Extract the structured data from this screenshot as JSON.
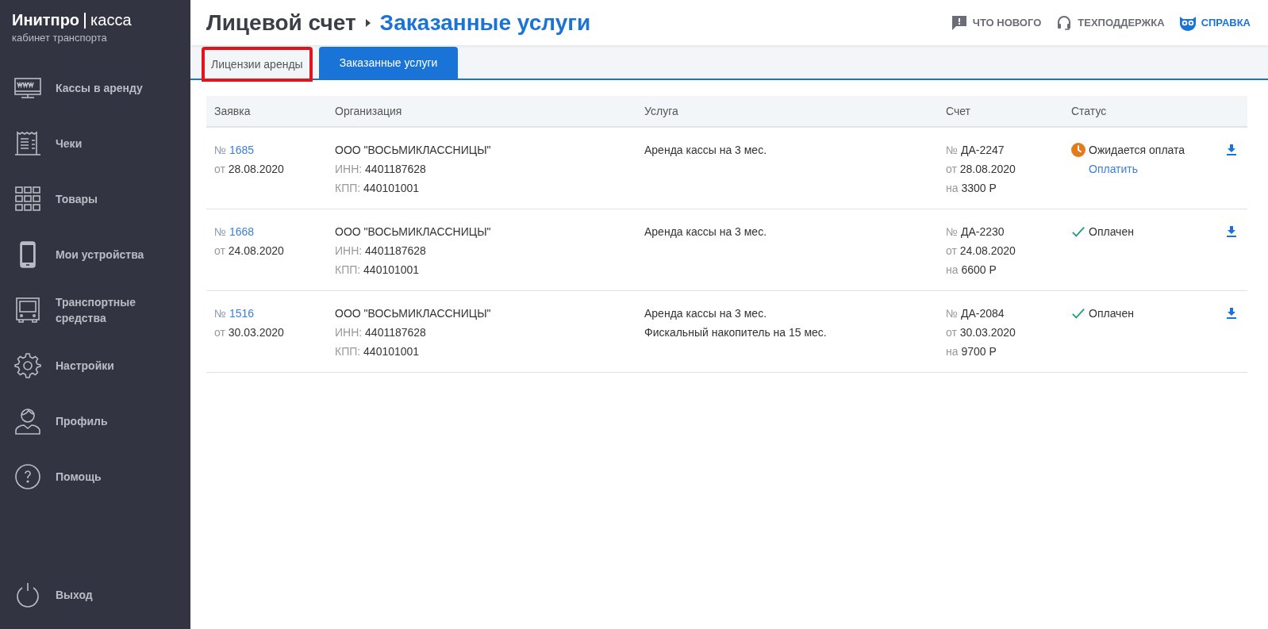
{
  "logo": {
    "brand": "Инитпро",
    "product": "касса",
    "subtitle": "кабинет транспорта"
  },
  "sidebar": {
    "items": [
      {
        "label": "Кассы в аренду"
      },
      {
        "label": "Чеки"
      },
      {
        "label": "Товары"
      },
      {
        "label": "Мои устройства"
      },
      {
        "label": "Транспортные средства"
      },
      {
        "label": "Настройки"
      },
      {
        "label": "Профиль"
      },
      {
        "label": "Помощь"
      }
    ],
    "logout": {
      "label": "Выход"
    }
  },
  "header": {
    "breadcrumb": "Лицевой счет",
    "title": "Заказанные услуги",
    "links": [
      {
        "label": "ЧТО НОВОГО"
      },
      {
        "label": "ТЕХПОДДЕРЖКА"
      },
      {
        "label": "СПРАВКА"
      }
    ]
  },
  "tabs": [
    {
      "label": "Лицензии аренды",
      "selected": false,
      "highlighted": true
    },
    {
      "label": "Заказанные услуги",
      "selected": true,
      "highlighted": false
    }
  ],
  "table": {
    "columns": [
      "Заявка",
      "Организация",
      "Услуга",
      "Счет",
      "Статус"
    ],
    "rows": [
      {
        "number_label": "№",
        "number": "1685",
        "date_label": "от",
        "date": "28.08.2020",
        "org": "ООО \"ВОСЬМИКЛАССНИЦЫ\"",
        "inn_label": "ИНН:",
        "inn": "4401187628",
        "kpp_label": "КПП:",
        "kpp": "440101001",
        "services": [
          "Аренда кассы на 3 мес."
        ],
        "invoice_label": "№",
        "invoice": "ДА-2247",
        "invoice_date_label": "от",
        "invoice_date": "28.08.2020",
        "amount_label": "на",
        "amount": "3300 Р",
        "status": {
          "kind": "pending",
          "label": "Ожидается оплата",
          "action": "Оплатить"
        }
      },
      {
        "number_label": "№",
        "number": "1668",
        "date_label": "от",
        "date": "24.08.2020",
        "org": "ООО \"ВОСЬМИКЛАССНИЦЫ\"",
        "inn_label": "ИНН:",
        "inn": "4401187628",
        "kpp_label": "КПП:",
        "kpp": "440101001",
        "services": [
          "Аренда кассы на 3 мес."
        ],
        "invoice_label": "№",
        "invoice": "ДА-2230",
        "invoice_date_label": "от",
        "invoice_date": "24.08.2020",
        "amount_label": "на",
        "amount": "6600 Р",
        "status": {
          "kind": "paid",
          "label": "Оплачен"
        }
      },
      {
        "number_label": "№",
        "number": "1516",
        "date_label": "от",
        "date": "30.03.2020",
        "org": "ООО \"ВОСЬМИКЛАССНИЦЫ\"",
        "inn_label": "ИНН:",
        "inn": "4401187628",
        "kpp_label": "КПП:",
        "kpp": "440101001",
        "services": [
          "Аренда кассы на 3 мес.",
          "Фискальный накопитель на 15 мес."
        ],
        "invoice_label": "№",
        "invoice": "ДА-2084",
        "invoice_date_label": "от",
        "invoice_date": "30.03.2020",
        "amount_label": "на",
        "amount": "9700 Р",
        "status": {
          "kind": "paid",
          "label": "Оплачен"
        }
      }
    ]
  }
}
